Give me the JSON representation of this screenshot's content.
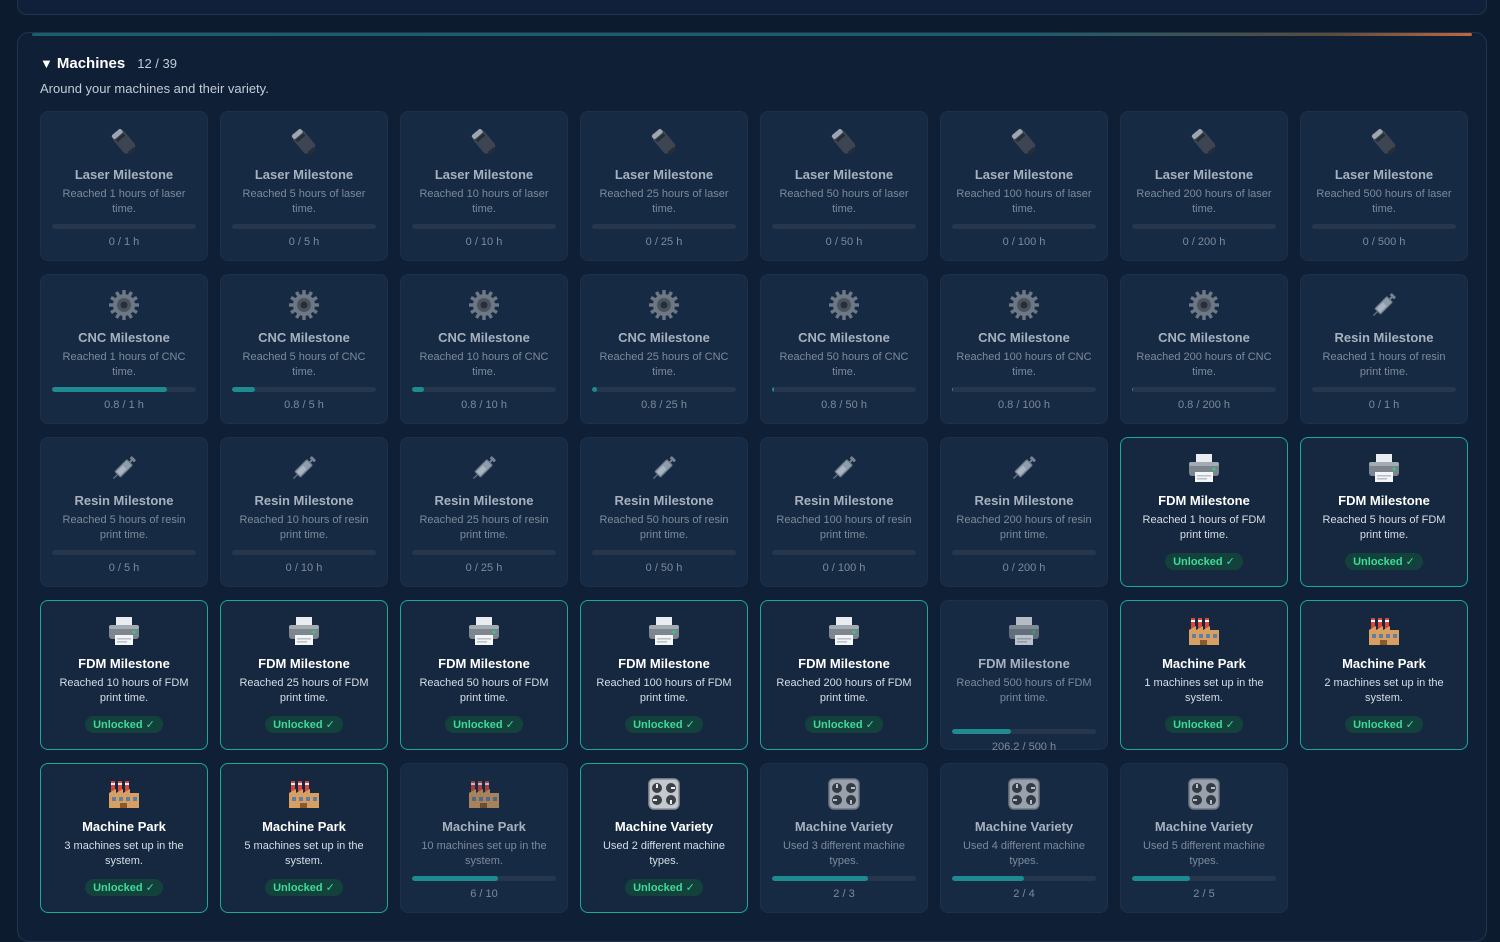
{
  "section": {
    "title": "Machines",
    "count": "12 / 39",
    "subtitle": "Around your machines and their variety."
  },
  "accent_color": "#1aa89a",
  "badge_text": "Unlocked ✓",
  "achievements": [
    {
      "name": "Laser Milestone",
      "icon": "laser-icon",
      "desc": "Reached 1 hours of laser time.",
      "unlocked": false,
      "progress": "0 / 1 h",
      "fill": 0
    },
    {
      "name": "Laser Milestone",
      "icon": "laser-icon",
      "desc": "Reached 5 hours of laser time.",
      "unlocked": false,
      "progress": "0 / 5 h",
      "fill": 0
    },
    {
      "name": "Laser Milestone",
      "icon": "laser-icon",
      "desc": "Reached 10 hours of laser time.",
      "unlocked": false,
      "progress": "0 / 10 h",
      "fill": 0
    },
    {
      "name": "Laser Milestone",
      "icon": "laser-icon",
      "desc": "Reached 25 hours of laser time.",
      "unlocked": false,
      "progress": "0 / 25 h",
      "fill": 0
    },
    {
      "name": "Laser Milestone",
      "icon": "laser-icon",
      "desc": "Reached 50 hours of laser time.",
      "unlocked": false,
      "progress": "0 / 50 h",
      "fill": 0
    },
    {
      "name": "Laser Milestone",
      "icon": "laser-icon",
      "desc": "Reached 100 hours of laser time.",
      "unlocked": false,
      "progress": "0 / 100 h",
      "fill": 0
    },
    {
      "name": "Laser Milestone",
      "icon": "laser-icon",
      "desc": "Reached 200 hours of laser time.",
      "unlocked": false,
      "progress": "0 / 200 h",
      "fill": 0
    },
    {
      "name": "Laser Milestone",
      "icon": "laser-icon",
      "desc": "Reached 500 hours of laser time.",
      "unlocked": false,
      "progress": "0 / 500 h",
      "fill": 0
    },
    {
      "name": "CNC Milestone",
      "icon": "gear-icon",
      "desc": "Reached 1 hours of CNC time.",
      "unlocked": false,
      "progress": "0.8 / 1 h",
      "fill": 0.8
    },
    {
      "name": "CNC Milestone",
      "icon": "gear-icon",
      "desc": "Reached 5 hours of CNC time.",
      "unlocked": false,
      "progress": "0.8 / 5 h",
      "fill": 0.16
    },
    {
      "name": "CNC Milestone",
      "icon": "gear-icon",
      "desc": "Reached 10 hours of CNC time.",
      "unlocked": false,
      "progress": "0.8 / 10 h",
      "fill": 0.08
    },
    {
      "name": "CNC Milestone",
      "icon": "gear-icon",
      "desc": "Reached 25 hours of CNC time.",
      "unlocked": false,
      "progress": "0.8 / 25 h",
      "fill": 0.032
    },
    {
      "name": "CNC Milestone",
      "icon": "gear-icon",
      "desc": "Reached 50 hours of CNC time.",
      "unlocked": false,
      "progress": "0.8 / 50 h",
      "fill": 0.016
    },
    {
      "name": "CNC Milestone",
      "icon": "gear-icon",
      "desc": "Reached 100 hours of CNC time.",
      "unlocked": false,
      "progress": "0.8 / 100 h",
      "fill": 0.008
    },
    {
      "name": "CNC Milestone",
      "icon": "gear-icon",
      "desc": "Reached 200 hours of CNC time.",
      "unlocked": false,
      "progress": "0.8 / 200 h",
      "fill": 0.004
    },
    {
      "name": "Resin Milestone",
      "icon": "syringe-icon",
      "desc": "Reached 1 hours of resin print time.",
      "unlocked": false,
      "progress": "0 / 1 h",
      "fill": 0
    },
    {
      "name": "Resin Milestone",
      "icon": "syringe-icon",
      "desc": "Reached 5 hours of resin print time.",
      "unlocked": false,
      "progress": "0 / 5 h",
      "fill": 0
    },
    {
      "name": "Resin Milestone",
      "icon": "syringe-icon",
      "desc": "Reached 10 hours of resin print time.",
      "unlocked": false,
      "progress": "0 / 10 h",
      "fill": 0
    },
    {
      "name": "Resin Milestone",
      "icon": "syringe-icon",
      "desc": "Reached 25 hours of resin print time.",
      "unlocked": false,
      "progress": "0 / 25 h",
      "fill": 0
    },
    {
      "name": "Resin Milestone",
      "icon": "syringe-icon",
      "desc": "Reached 50 hours of resin print time.",
      "unlocked": false,
      "progress": "0 / 50 h",
      "fill": 0
    },
    {
      "name": "Resin Milestone",
      "icon": "syringe-icon",
      "desc": "Reached 100 hours of resin print time.",
      "unlocked": false,
      "progress": "0 / 100 h",
      "fill": 0
    },
    {
      "name": "Resin Milestone",
      "icon": "syringe-icon",
      "desc": "Reached 200 hours of resin print time.",
      "unlocked": false,
      "progress": "0 / 200 h",
      "fill": 0
    },
    {
      "name": "FDM Milestone",
      "icon": "printer-icon",
      "desc": "Reached 1 hours of FDM print time.",
      "unlocked": true
    },
    {
      "name": "FDM Milestone",
      "icon": "printer-icon",
      "desc": "Reached 5 hours of FDM print time.",
      "unlocked": true
    },
    {
      "name": "FDM Milestone",
      "icon": "printer-icon",
      "desc": "Reached 10 hours of FDM print time.",
      "unlocked": true
    },
    {
      "name": "FDM Milestone",
      "icon": "printer-icon",
      "desc": "Reached 25 hours of FDM print time.",
      "unlocked": true
    },
    {
      "name": "FDM Milestone",
      "icon": "printer-icon",
      "desc": "Reached 50 hours of FDM print time.",
      "unlocked": true
    },
    {
      "name": "FDM Milestone",
      "icon": "printer-icon",
      "desc": "Reached 100 hours of FDM print time.",
      "unlocked": true
    },
    {
      "name": "FDM Milestone",
      "icon": "printer-icon",
      "desc": "Reached 200 hours of FDM print time.",
      "unlocked": true
    },
    {
      "name": "FDM Milestone",
      "icon": "printer-icon",
      "desc": "Reached 500 hours of FDM print time.",
      "unlocked": false,
      "progress": "206.2 / 500 h",
      "fill": 0.41
    },
    {
      "name": "Machine Park",
      "icon": "factory-icon",
      "desc": "1 machines set up in the system.",
      "unlocked": true
    },
    {
      "name": "Machine Park",
      "icon": "factory-icon",
      "desc": "2 machines set up in the system.",
      "unlocked": true
    },
    {
      "name": "Machine Park",
      "icon": "factory-icon",
      "desc": "3 machines set up in the system.",
      "unlocked": true
    },
    {
      "name": "Machine Park",
      "icon": "factory-icon",
      "desc": "5 machines set up in the system.",
      "unlocked": true
    },
    {
      "name": "Machine Park",
      "icon": "factory-icon",
      "desc": "10 machines set up in the system.",
      "unlocked": false,
      "progress": "6 / 10",
      "fill": 0.6
    },
    {
      "name": "Machine Variety",
      "icon": "control-knobs-icon",
      "desc": "Used 2 different machine types.",
      "unlocked": true
    },
    {
      "name": "Machine Variety",
      "icon": "control-knobs-icon",
      "desc": "Used 3 different machine types.",
      "unlocked": false,
      "progress": "2 / 3",
      "fill": 0.667
    },
    {
      "name": "Machine Variety",
      "icon": "control-knobs-icon",
      "desc": "Used 4 different machine types.",
      "unlocked": false,
      "progress": "2 / 4",
      "fill": 0.5
    },
    {
      "name": "Machine Variety",
      "icon": "control-knobs-icon",
      "desc": "Used 5 different machine types.",
      "unlocked": false,
      "progress": "2 / 5",
      "fill": 0.4
    }
  ]
}
